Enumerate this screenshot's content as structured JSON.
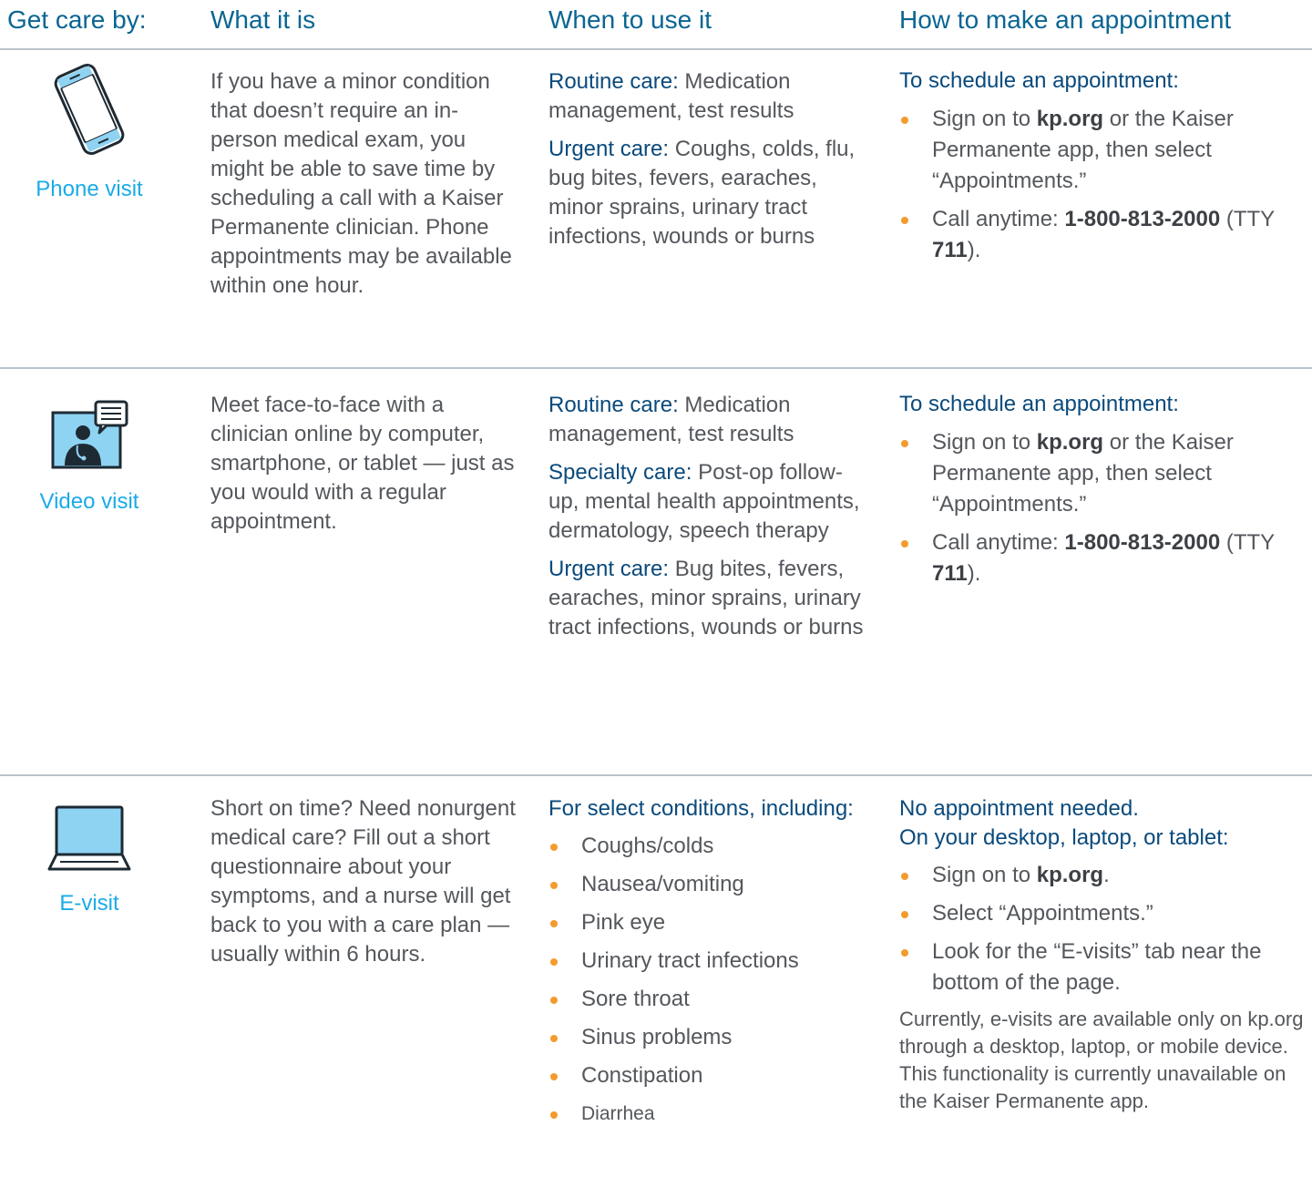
{
  "headers": {
    "col1": "Get care by:",
    "col2": "What it is",
    "col3": "When to use it",
    "col4": "How to make an appointment"
  },
  "phone": {
    "label": "Phone visit",
    "icon": "smartphone-icon",
    "what": "If you have a minor condition that doesn’t require an in-person medical exam, you might be able to save time by scheduling a call with a Kaiser Permanente clinician. Phone appointments may be available within one hour.",
    "routine_label": "Routine care:",
    "routine_text": " Medication management, test results",
    "urgent_label": "Urgent care:",
    "urgent_text": " Coughs, colds, flu, bug bites, fevers, earaches, minor sprains, urinary tract infections, wounds or burns",
    "schedule_heading": "To schedule an appointment:",
    "b1_pre": "Sign on to ",
    "b1_bold": "kp.org",
    "b1_post": " or the Kaiser Permanente app, then select “Appointments.”",
    "b2_pre": "Call anytime: ",
    "b2_phone": "1-800-813-2000",
    "b2_mid": " (TTY ",
    "b2_tty": "711",
    "b2_post": ")."
  },
  "video": {
    "label": "Video visit",
    "icon": "video-visit-icon",
    "what": "Meet face-to-face with a clinician online by computer, smartphone, or tablet — just as you would with a regular appointment.",
    "routine_label": "Routine care:",
    "routine_text": " Medication management, test results",
    "specialty_label": "Specialty care:",
    "specialty_text": " Post-op follow-up, mental health appointments, dermatology, speech therapy",
    "urgent_label": "Urgent care:",
    "urgent_text": " Bug bites, fevers, earaches, minor sprains, urinary tract infections, wounds or burns",
    "schedule_heading": "To schedule an appointment:",
    "b1_pre": "Sign on to ",
    "b1_bold": "kp.org",
    "b1_post": " or the Kaiser Permanente app, then select “Appointments.”",
    "b2_pre": "Call anytime: ",
    "b2_phone": "1-800-813-2000",
    "b2_mid": " (TTY ",
    "b2_tty": "711",
    "b2_post": ")."
  },
  "evisit": {
    "label": "E-visit",
    "icon": "laptop-icon",
    "what": "Short on time? Need nonurgent medical care? Fill out a short questionnaire about your symptoms, and a nurse will get back to you with a care plan — usually within 6 hours.",
    "conditions_heading": "For select conditions, including:",
    "conditions": [
      "Coughs/colds",
      "Nausea/vomiting",
      "Pink eye",
      "Urinary tract infections",
      "Sore throat",
      "Sinus problems",
      "Constipation",
      "Diarrhea"
    ],
    "how_heading_1": "No appointment needed.",
    "how_heading_2": "On your desktop, laptop, or tablet:",
    "h1_pre": "Sign on to ",
    "h1_bold": "kp.org",
    "h1_post": ".",
    "h2": "Select “Appointments.”",
    "h3": "Look for the “E-visits” tab near the bottom of the page.",
    "note": "Currently, e-visits are available only on kp.org through a desktop, laptop, or mobile device. This functionality is currently unavailable on the Kaiser Permanente app."
  },
  "colors": {
    "header_blue": "#0a6592",
    "label_cyan": "#1aabe6",
    "dark_blue": "#0a4a7c",
    "bullet_orange": "#f39b2e",
    "body_gray": "#54575c"
  }
}
